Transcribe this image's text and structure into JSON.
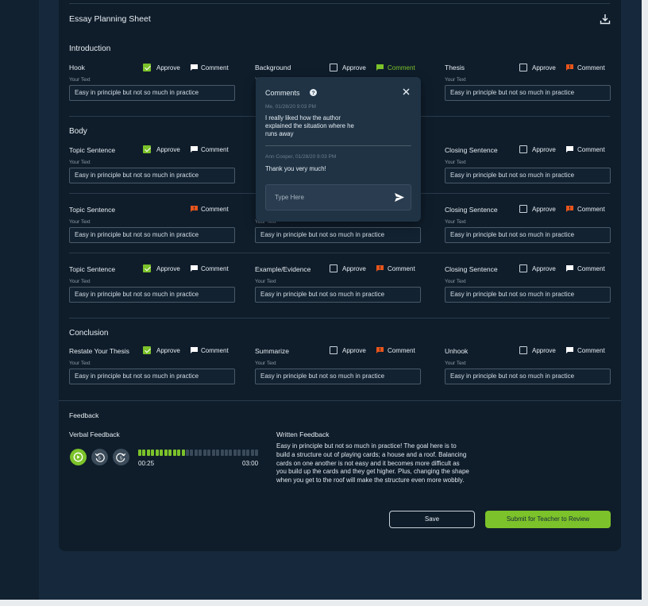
{
  "title": "Essay Planning Sheet",
  "colors": {
    "accent": "#7cc22a",
    "comment_alert": "#e8551b",
    "panel": "#0f1d2b",
    "page": "#16283b"
  },
  "icons": {
    "download": "download-icon",
    "comment": "comment-bubble-icon",
    "info": "info-icon",
    "close": "close-icon",
    "send": "send-icon",
    "play": "play-icon",
    "rewind": "rewind-5-icon",
    "forward": "forward-5-icon"
  },
  "labels": {
    "approve": "Approve",
    "comment": "Comment",
    "your_text": "Your Text"
  },
  "input_value": "Easy in principle but not so much in practice",
  "sections": {
    "intro": "Introduction",
    "body": "Body",
    "conclusion": "Conclusion"
  },
  "fields": {
    "hook": "Hook",
    "background": "Background",
    "thesis": "Thesis",
    "topic": "Topic Sentence",
    "closing": "Closing Sentence",
    "example": "Example/Evidence",
    "restate": "Restate Your Thesis",
    "summarize": "Summarize",
    "unhook": "Unhook"
  },
  "popup": {
    "title": "Comments",
    "c1_meta": "Me, 01/28/20 9:03 PM",
    "c1_text": "I really liked how the author explained the situation where he runs away",
    "c2_meta": "Ann Cooper, 01/28/20 9:03 PM",
    "c2_text": "Thank you very much!",
    "placeholder": "Type Here"
  },
  "feedback": {
    "heading": "Feedback",
    "verbal": "Verbal Feedback",
    "written": "Written Feedback",
    "elapsed": "00:25",
    "total": "03:00",
    "progress": 0.39,
    "text": "Easy in principle but not so much in practice! The goal here is to build a structure out of playing cards; a house and a roof. Balancing cards on one another is not easy and it becomes more difficult as you build up the cards and they get higher. Plus, changing the shape when you get to the roof will make the structure even more wobbly."
  },
  "buttons": {
    "save": "Save",
    "submit": "Submit for Teacher to Review"
  }
}
